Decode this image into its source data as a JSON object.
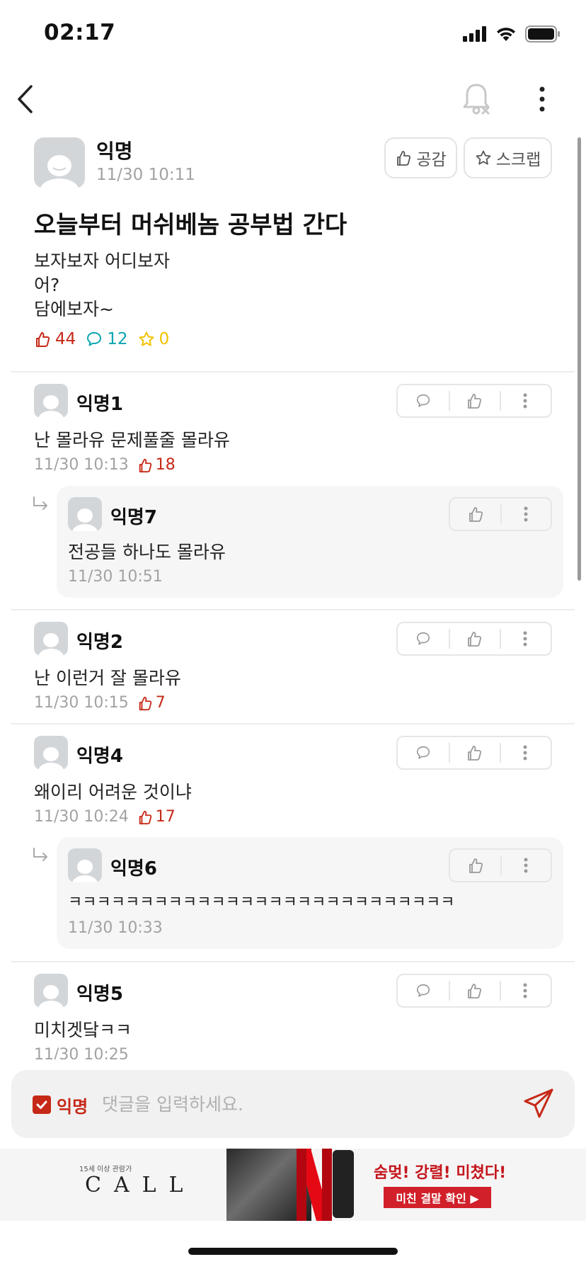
{
  "status_bar": {
    "time": "02:17"
  },
  "post": {
    "author": "익명",
    "time": "11/30 10:11",
    "like_button": "공감",
    "scrap_button": "스크랩",
    "title": "오늘부터 머쉬베놈 공부법 간다",
    "body_lines": [
      "보자보자 어디보자",
      "어?",
      "담에보자~"
    ],
    "stats": {
      "likes": "44",
      "comments": "12",
      "scraps": "0"
    }
  },
  "comments": [
    {
      "author": "익명1",
      "text": "난 몰라유 문제풀줄 몰라유",
      "time": "11/30 10:13",
      "likes": "18"
    },
    {
      "author": "익명2",
      "text": "난 이런거 잘 몰라유",
      "time": "11/30 10:15",
      "likes": "7"
    },
    {
      "author": "익명4",
      "text": "왜이리 어려운 것이냐",
      "time": "11/30 10:24",
      "likes": "17"
    },
    {
      "author": "익명5",
      "text": "미치겟닼ㅋㅋ",
      "time": "11/30 10:25"
    }
  ],
  "replies": [
    {
      "author": "익명7",
      "text": "전공들 하나도 몰라유",
      "time": "11/30 10:51"
    },
    {
      "author": "익명6",
      "text": "ㅋㅋㅋㅋㅋㅋㅋㅋㅋㅋㅋㅋㅋㅋㅋㅋㅋㅋㅋㅋㅋㅋㅋㅋㅋㅋㅋ",
      "time": "11/30 10:33"
    }
  ],
  "input": {
    "anon_label": "익명",
    "placeholder": "댓글을 입력하세요."
  },
  "ad": {
    "rating": "15세 이상 관람가",
    "logo": "CALL",
    "headline": "숨멎! 강렬! 미쳤다!",
    "cta": "미친 결말 확인 ▶"
  },
  "colors": {
    "accent": "#c62917",
    "comment": "#0ca5b0",
    "scrap": "#f2c200",
    "muted": "#a2a2a2"
  }
}
